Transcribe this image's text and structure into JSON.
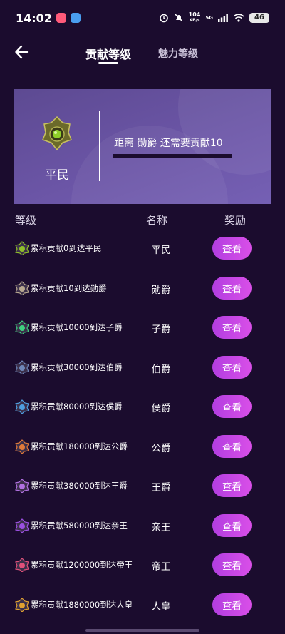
{
  "status_bar": {
    "time": "14:02",
    "speed_top": "104",
    "speed_bottom": "KB/s",
    "network": "5G",
    "battery": "46",
    "icons": [
      "alarm-icon",
      "mute-icon",
      "signal-icon",
      "wifi-icon"
    ]
  },
  "header": {
    "back_icon": "arrow-left-icon",
    "tabs": [
      {
        "label": "贡献等级",
        "active": true
      },
      {
        "label": "魅力等级",
        "active": false
      }
    ]
  },
  "card": {
    "current_level": "平民",
    "progress_text": "距离 勋爵 还需要贡献10",
    "progress": 0
  },
  "table": {
    "headers": {
      "level": "等级",
      "name": "名称",
      "reward": "奖励"
    },
    "rows": [
      {
        "desc": "累积贡献0到达平民",
        "name": "平民",
        "button": "查看",
        "badge_color": "#8fbf2a"
      },
      {
        "desc": "累积贡献10到达勋爵",
        "name": "勋爵",
        "button": "查看",
        "badge_color": "#b8a890"
      },
      {
        "desc": "累积贡献10000到达子爵",
        "name": "子爵",
        "button": "查看",
        "badge_color": "#3fcf7f"
      },
      {
        "desc": "累积贡献30000到达伯爵",
        "name": "伯爵",
        "button": "查看",
        "badge_color": "#6f86b8"
      },
      {
        "desc": "累积贡献80000到达侯爵",
        "name": "侯爵",
        "button": "查看",
        "badge_color": "#4f9fe0"
      },
      {
        "desc": "累积贡献180000到达公爵",
        "name": "公爵",
        "button": "查看",
        "badge_color": "#e07a3a"
      },
      {
        "desc": "累积贡献380000到达王爵",
        "name": "王爵",
        "button": "查看",
        "badge_color": "#b070e0"
      },
      {
        "desc": "累积贡献580000到达亲王",
        "name": "亲王",
        "button": "查看",
        "badge_color": "#9a4fe0"
      },
      {
        "desc": "累积贡献1200000到达帝王",
        "name": "帝王",
        "button": "查看",
        "badge_color": "#e0507a"
      },
      {
        "desc": "累积贡献1880000到达人皇",
        "name": "人皇",
        "button": "查看",
        "badge_color": "#e0a030"
      }
    ]
  }
}
